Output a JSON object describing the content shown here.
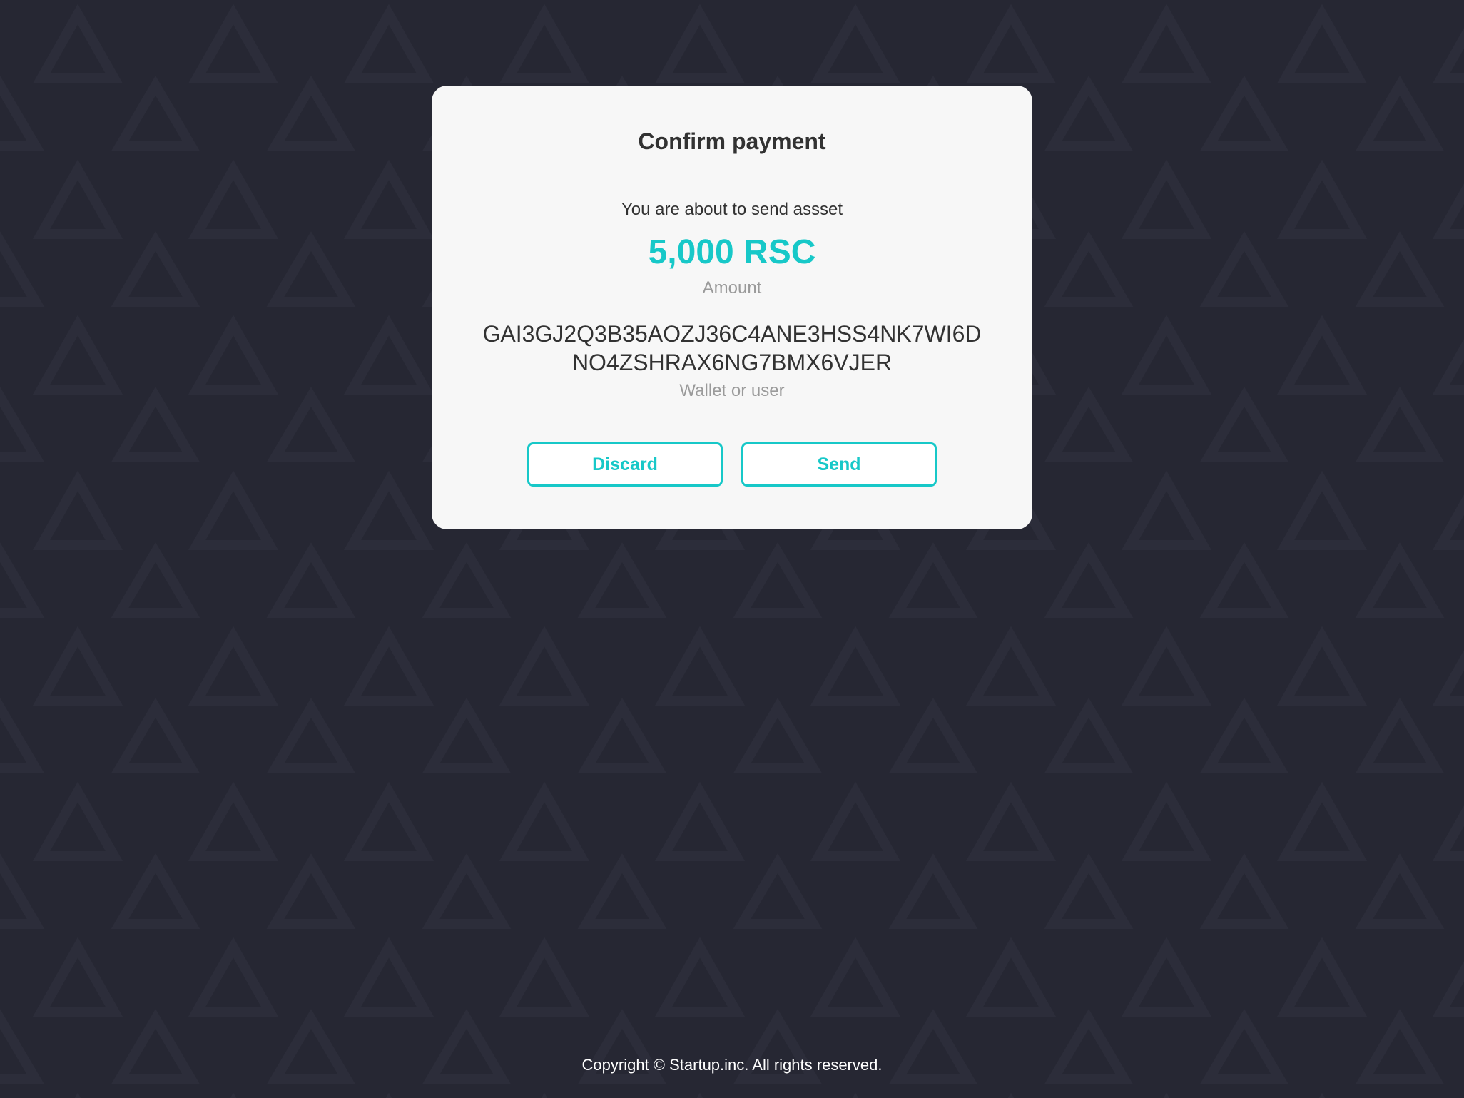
{
  "dialog": {
    "title": "Confirm payment",
    "intro": "You are about to send assset",
    "amount": {
      "value": "5,000 RSC",
      "label": "Amount"
    },
    "recipient": {
      "value": "GAI3GJ2Q3B35AOZJ36C4ANE3HSS4NK7WI6DNO4ZSHRAX6NG7BMX6VJER",
      "label": "Wallet or user"
    },
    "buttons": {
      "discard_label": "Discard",
      "send_label": "Send"
    }
  },
  "footer": {
    "copyright": "Copyright © Startup.inc. All rights reserved."
  },
  "colors": {
    "background": "#262733",
    "card": "#f7f7f7",
    "accent": "#17c8c8",
    "text": "#323232",
    "muted": "#9a9a9a"
  }
}
